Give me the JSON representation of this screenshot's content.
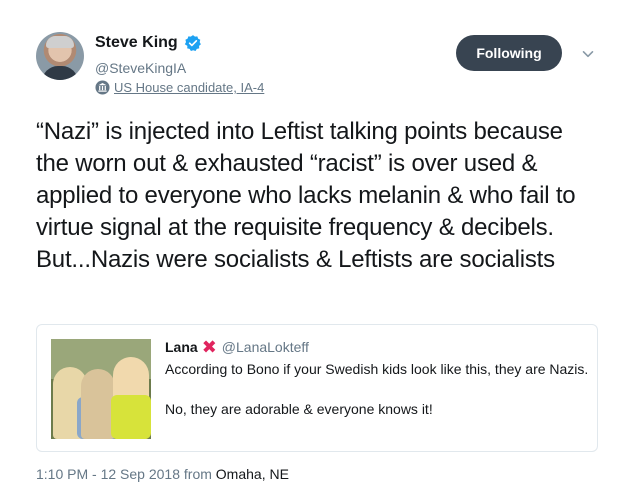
{
  "author": {
    "name": "Steve King",
    "handle": "@SteveKingIA",
    "label": "US House candidate, IA-4"
  },
  "follow_button": "Following",
  "tweet": {
    "text": "“Nazi” is injected into Leftist talking points because the worn out & exhausted “racist” is over used & applied to everyone who lacks melanin & who fail to virtue signal at the requisite frequency & decibels. But...Nazis were socialists & Leftists are socialists"
  },
  "quoted_tweet": {
    "name": "Lana",
    "name_mark": "✖",
    "handle": "@LanaLokteff",
    "line1": "According to Bono if your Swedish kids look like this, they are Nazis.",
    "line2": "No, they are adorable & everyone knows it!"
  },
  "meta": {
    "timestamp": "1:10 PM - 12 Sep 2018",
    "from_word": "from",
    "place": "Omaha, NE"
  },
  "colors": {
    "verified": "#1da1f2",
    "button": "#384451",
    "secondary_text": "#657786",
    "x_mark": "#e0245e"
  },
  "icons": [
    "verified-badge-icon",
    "government-building-icon",
    "chevron-down-icon"
  ]
}
